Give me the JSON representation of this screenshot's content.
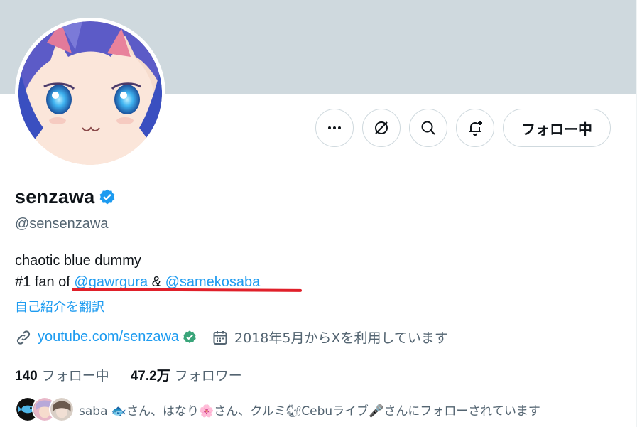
{
  "profile": {
    "display_name": "senzawa",
    "handle": "@sensenzawa",
    "bio_line1": "chaotic blue dummy",
    "bio_prefix": "#1 fan of",
    "bio_mention1": "@gawrgura",
    "bio_amp": "&",
    "bio_mention2": "@samekosaba",
    "translate_label": "自己紹介を翻訳",
    "website": "youtube.com/senzawa",
    "joined": "2018年5月からXを利用しています"
  },
  "actions": {
    "more_icon": "more-icon",
    "grok_icon": "grok-icon",
    "search_icon": "search-icon",
    "notify_icon": "notification-add-icon",
    "follow_label": "フォロー中"
  },
  "stats": {
    "following_count": "140",
    "following_label": "フォロー中",
    "followers_count": "47.2万",
    "followers_label": "フォロワー"
  },
  "followers_you_know": {
    "text": "saba 🐟さん、はなり🌸さん、クルミ🐿Cebuライブ🎤さんにフォローされています"
  },
  "colors": {
    "accent": "#1d9bf0",
    "banner": "#cfd9de",
    "secondary_text": "#536471",
    "annotation_red": "#e0202a"
  }
}
